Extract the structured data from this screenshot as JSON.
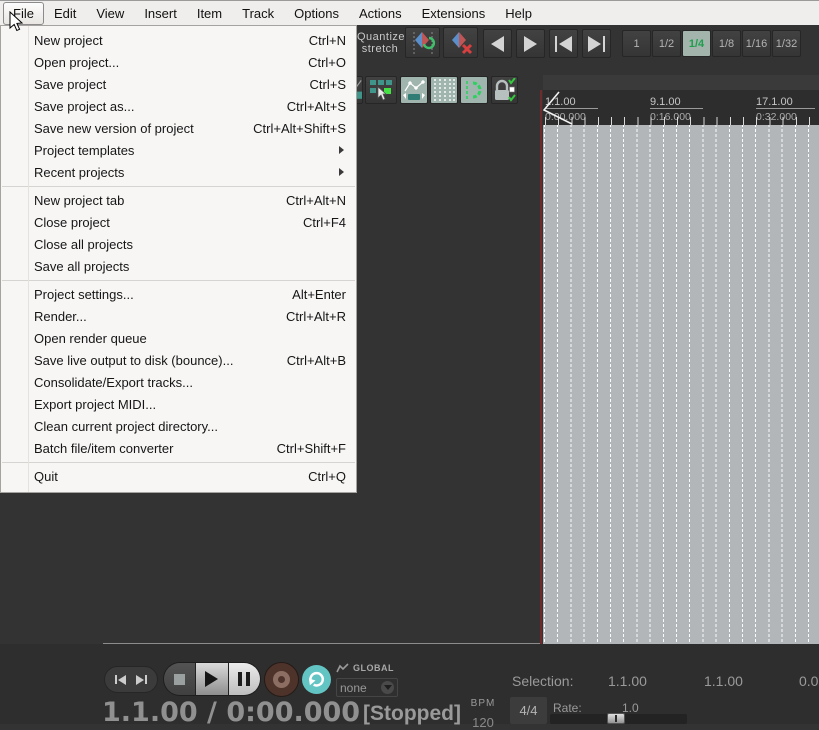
{
  "menubar": {
    "items": [
      "File",
      "Edit",
      "View",
      "Insert",
      "Item",
      "Track",
      "Options",
      "Actions",
      "Extensions",
      "Help"
    ],
    "active": "File"
  },
  "file_menu": {
    "items": [
      {
        "label": "New project",
        "shortcut": "Ctrl+N"
      },
      {
        "label": "Open project...",
        "shortcut": "Ctrl+O"
      },
      {
        "label": "Save project",
        "shortcut": "Ctrl+S"
      },
      {
        "label": "Save project as...",
        "shortcut": "Ctrl+Alt+S"
      },
      {
        "label": "Save new version of project",
        "shortcut": "Ctrl+Alt+Shift+S"
      },
      {
        "label": "Project templates",
        "shortcut": "",
        "submenu": true
      },
      {
        "label": "Recent projects",
        "shortcut": "",
        "submenu": true
      },
      {
        "label": "New project tab",
        "shortcut": "Ctrl+Alt+N"
      },
      {
        "label": "Close project",
        "shortcut": "Ctrl+F4"
      },
      {
        "label": "Close all projects",
        "shortcut": ""
      },
      {
        "label": "Save all projects",
        "shortcut": ""
      },
      {
        "label": "Project settings...",
        "shortcut": "Alt+Enter"
      },
      {
        "label": "Render...",
        "shortcut": "Ctrl+Alt+R"
      },
      {
        "label": "Open render queue",
        "shortcut": ""
      },
      {
        "label": "Save live output to disk (bounce)...",
        "shortcut": "Ctrl+Alt+B"
      },
      {
        "label": "Consolidate/Export tracks...",
        "shortcut": ""
      },
      {
        "label": "Export project MIDI...",
        "shortcut": ""
      },
      {
        "label": "Clean current project directory...",
        "shortcut": ""
      },
      {
        "label": "Batch file/item converter",
        "shortcut": "Ctrl+Shift+F"
      },
      {
        "label": "Quit",
        "shortcut": "Ctrl+Q"
      }
    ]
  },
  "toolbar": {
    "quantize_line1": "Quantize",
    "quantize_line2": "stretch",
    "grid_divisions": [
      "1",
      "1/2",
      "1/4",
      "1/8",
      "1/16",
      "1/32"
    ],
    "selected_division": "1/4"
  },
  "ruler": {
    "marks": [
      {
        "measure": "1.1.00",
        "time": "0:00.000"
      },
      {
        "measure": "9.1.00",
        "time": "0:16.000"
      },
      {
        "measure": "17.1.00",
        "time": "0:32.000"
      }
    ]
  },
  "transport": {
    "position": "1.1.00 / 0:00.000",
    "status": "[Stopped]",
    "automation_scope": "GLOBAL",
    "automation_mode": "none",
    "bpm_label": "BPM",
    "bpm_value": "120",
    "time_signature": "4/4",
    "rate_label": "Rate:",
    "rate_value": "1.0"
  },
  "selection": {
    "label": "Selection:",
    "start": "1.1.00",
    "end": "1.1.00",
    "length": "0.0"
  },
  "colors": {
    "accent_green": "#3fbf6a",
    "toggle_bg": "#a0b5ae",
    "teal": "#5fc6c0",
    "record_brown": "#8d6e63",
    "grid_bg": "#b3b6b8"
  }
}
